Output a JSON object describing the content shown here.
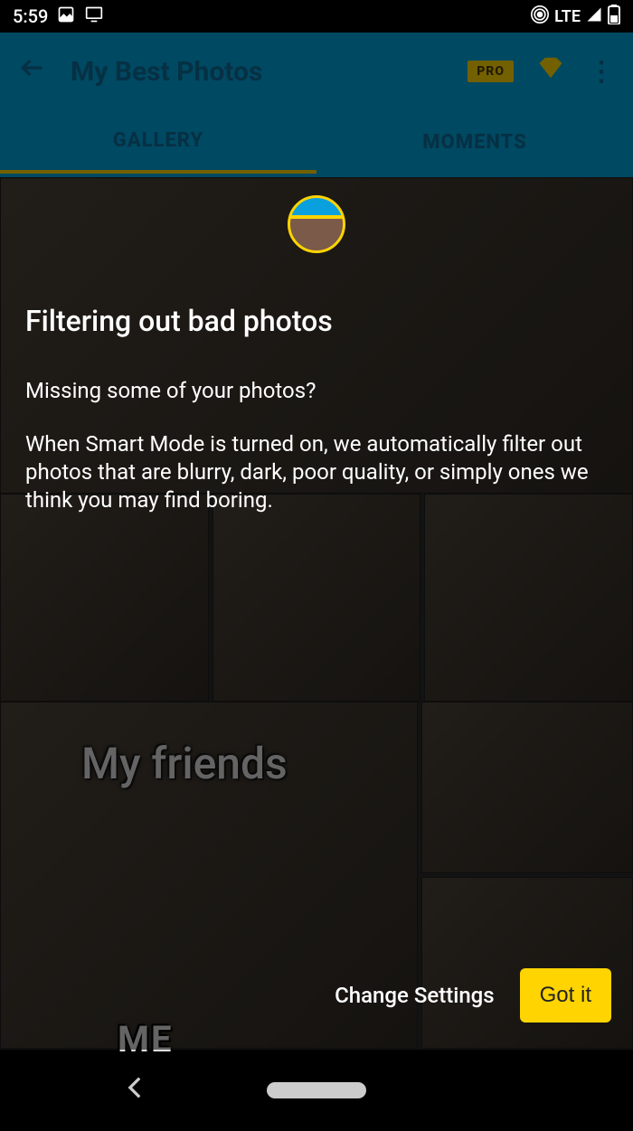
{
  "statusbar": {
    "time": "5:59",
    "lte": "LTE"
  },
  "appbar": {
    "title": "My Best Photos",
    "pro": "PRO"
  },
  "tabs": {
    "gallery": "GALLERY",
    "moments": "MOMENTS"
  },
  "gallery_text": {
    "friends": "My friends",
    "me": "ME"
  },
  "modal": {
    "title": "Filtering out bad photos",
    "subtitle": "Missing some of your photos?",
    "body": "When Smart Mode is turned on, we automatically filter out photos that are blurry, dark, poor quality, or simply ones we think you may find boring.",
    "change": "Change Settings",
    "gotit": "Got it"
  }
}
